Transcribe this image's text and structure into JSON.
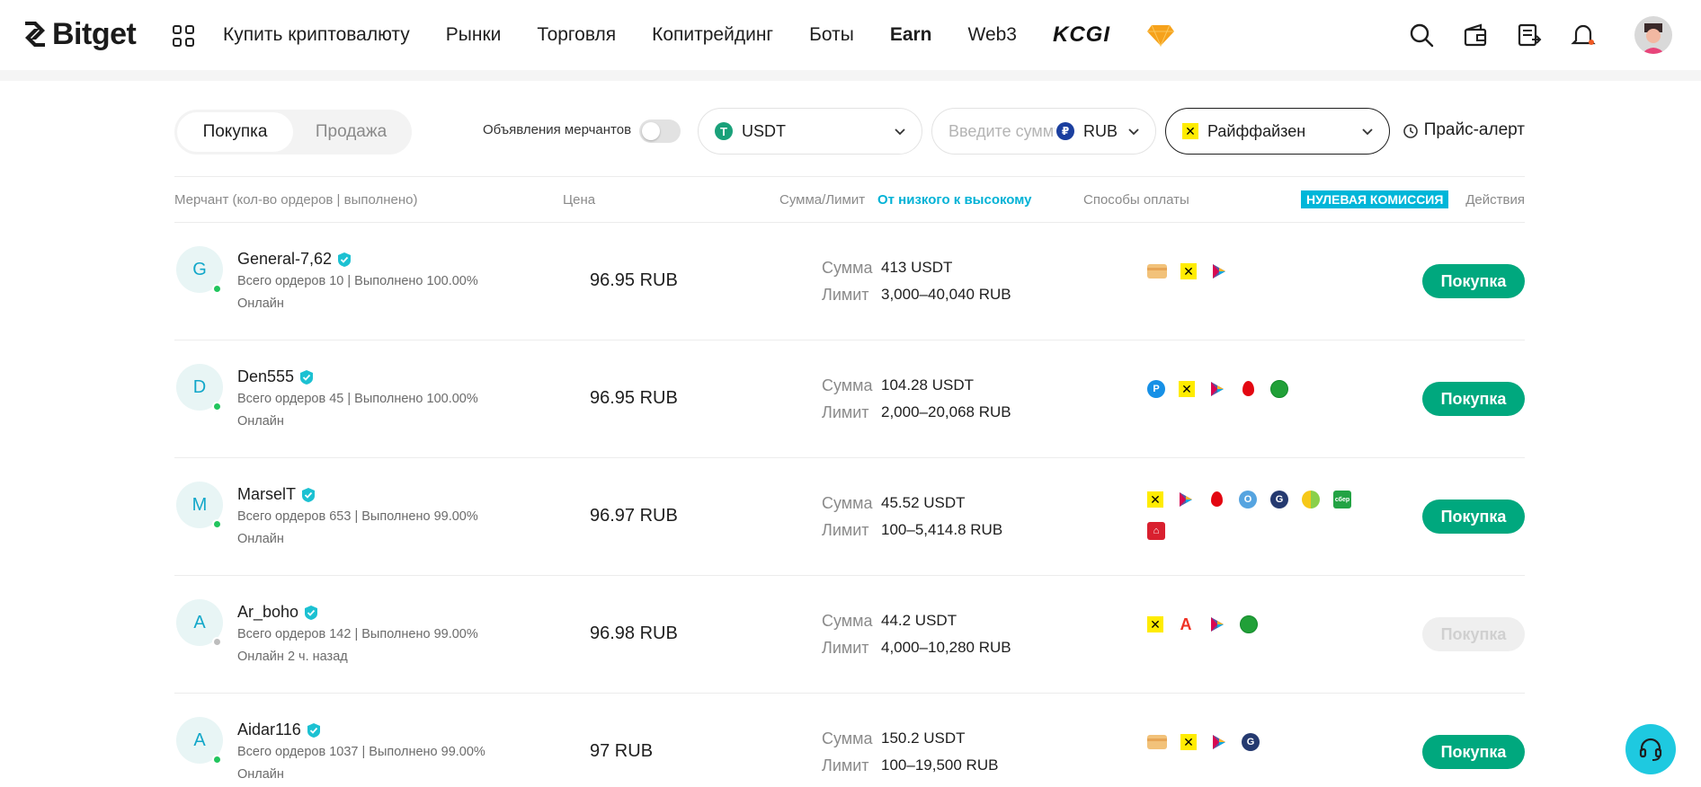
{
  "header": {
    "logo_text": "Bitget",
    "nav": [
      "Купить криптовалюту",
      "Рынки",
      "Торговля",
      "Копитрейдинг",
      "Боты",
      "Earn",
      "Web3"
    ],
    "kcgi_label": "KCGI"
  },
  "filters": {
    "side_buy": "Покупка",
    "side_sell": "Продажа",
    "merchant_ads_label": "Объявления мерчантов",
    "coin": "USDT",
    "amount_placeholder": "Введите сумму",
    "currency": "RUB",
    "payment_method": "Райффайзен",
    "price_alert": "Прайс-алерт"
  },
  "table": {
    "columns": {
      "merchant": "Мерчант (кол-во ордеров | выполнено)",
      "price": "Цена",
      "amount_limit": "Сумма/Лимит",
      "sort": "От низкого к высокому",
      "payment": "Способы оплаты",
      "zero_fee": "НУЛЕВАЯ КОМИССИЯ",
      "actions": "Действия"
    },
    "amount_label": "Сумма",
    "limit_label": "Лимит",
    "rows": [
      {
        "initial": "G",
        "name": "General-7,62",
        "stats": "Всего ордеров 10 | Выполнено 100.00%",
        "online": "Онлайн",
        "price": "96.95 RUB",
        "amount": "413 USDT",
        "limit": "3,000–40,040 RUB",
        "action": "Покупка"
      },
      {
        "initial": "D",
        "name": "Den555",
        "stats": "Всего ордеров 45 | Выполнено 100.00%",
        "online": "Онлайн",
        "price": "96.95 RUB",
        "amount": "104.28 USDT",
        "limit": "2,000–20,068 RUB",
        "action": "Покупка"
      },
      {
        "initial": "M",
        "name": "MarselT",
        "stats": "Всего ордеров 653 | Выполнено 99.00%",
        "online": "Онлайн",
        "price": "96.97 RUB",
        "amount": "45.52 USDT",
        "limit": "100–5,414.8 RUB",
        "action": "Покупка"
      },
      {
        "initial": "A",
        "name": "Ar_boho",
        "stats": "Всего ордеров 142 | Выполнено 99.00%",
        "online": "Онлайн 2 ч. назад",
        "price": "96.98 RUB",
        "amount": "44.2 USDT",
        "limit": "4,000–10,280 RUB",
        "action": "Покупка"
      },
      {
        "initial": "A",
        "name": "Aidar116",
        "stats": "Всего ордеров 1037 | Выполнено 99.00%",
        "online": "Онлайн",
        "price": "97 RUB",
        "amount": "150.2 USDT",
        "limit": "100–19,500 RUB",
        "action": "Покупка"
      }
    ]
  },
  "colors": {
    "accent": "#00a87e",
    "link": "#00b2d6",
    "support": "#1ec9e0"
  }
}
